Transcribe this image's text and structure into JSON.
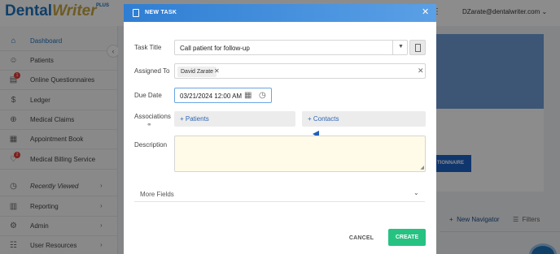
{
  "app": {
    "logo_main": "Dental",
    "logo_accent": "Writer",
    "logo_plus": "PLUS",
    "user_email": "DZarate@dentalwriter.com"
  },
  "sidebar": {
    "items": [
      {
        "label": "Dashboard",
        "icon": "home-icon"
      },
      {
        "label": "Patients",
        "icon": "people-icon"
      },
      {
        "label": "Online Questionnaires",
        "icon": "questionnaire-icon",
        "badge": "1"
      },
      {
        "label": "Ledger",
        "icon": "dollar-icon"
      },
      {
        "label": "Medical Claims",
        "icon": "claims-icon"
      },
      {
        "label": "Appointment Book",
        "icon": "calendar-icon"
      },
      {
        "label": "Medical Billing Service",
        "icon": "billing-icon",
        "badge": "2"
      },
      {
        "label": "Recently Viewed",
        "icon": "clock-icon"
      },
      {
        "label": "Reporting",
        "icon": "report-icon"
      },
      {
        "label": "Admin",
        "icon": "admin-icon"
      },
      {
        "label": "User Resources",
        "icon": "resources-icon"
      }
    ]
  },
  "background": {
    "questionnaire_btn": "TIONNAIRE",
    "new_navigator": "New Navigator",
    "filters": "Filters"
  },
  "modal": {
    "title": "NEW TASK",
    "task_title_label": "Task Title",
    "task_title_value": "Call patient for follow-up",
    "assigned_to_label": "Assigned To",
    "assignee": "David Zarate",
    "due_date_label": "Due Date",
    "due_date_value": "03/21/2024 12:00 AM",
    "associations_label": "Associations",
    "patients_btn": "+ Patients",
    "contacts_btn": "+ Contacts",
    "description_label": "Description",
    "more_fields": "More Fields",
    "cancel": "CANCEL",
    "create": "CREATE"
  },
  "colors": {
    "header_blue": "#2f7ed3",
    "create_green": "#26c281",
    "link_blue": "#2f66b3",
    "description_bg": "#fffbe8"
  }
}
